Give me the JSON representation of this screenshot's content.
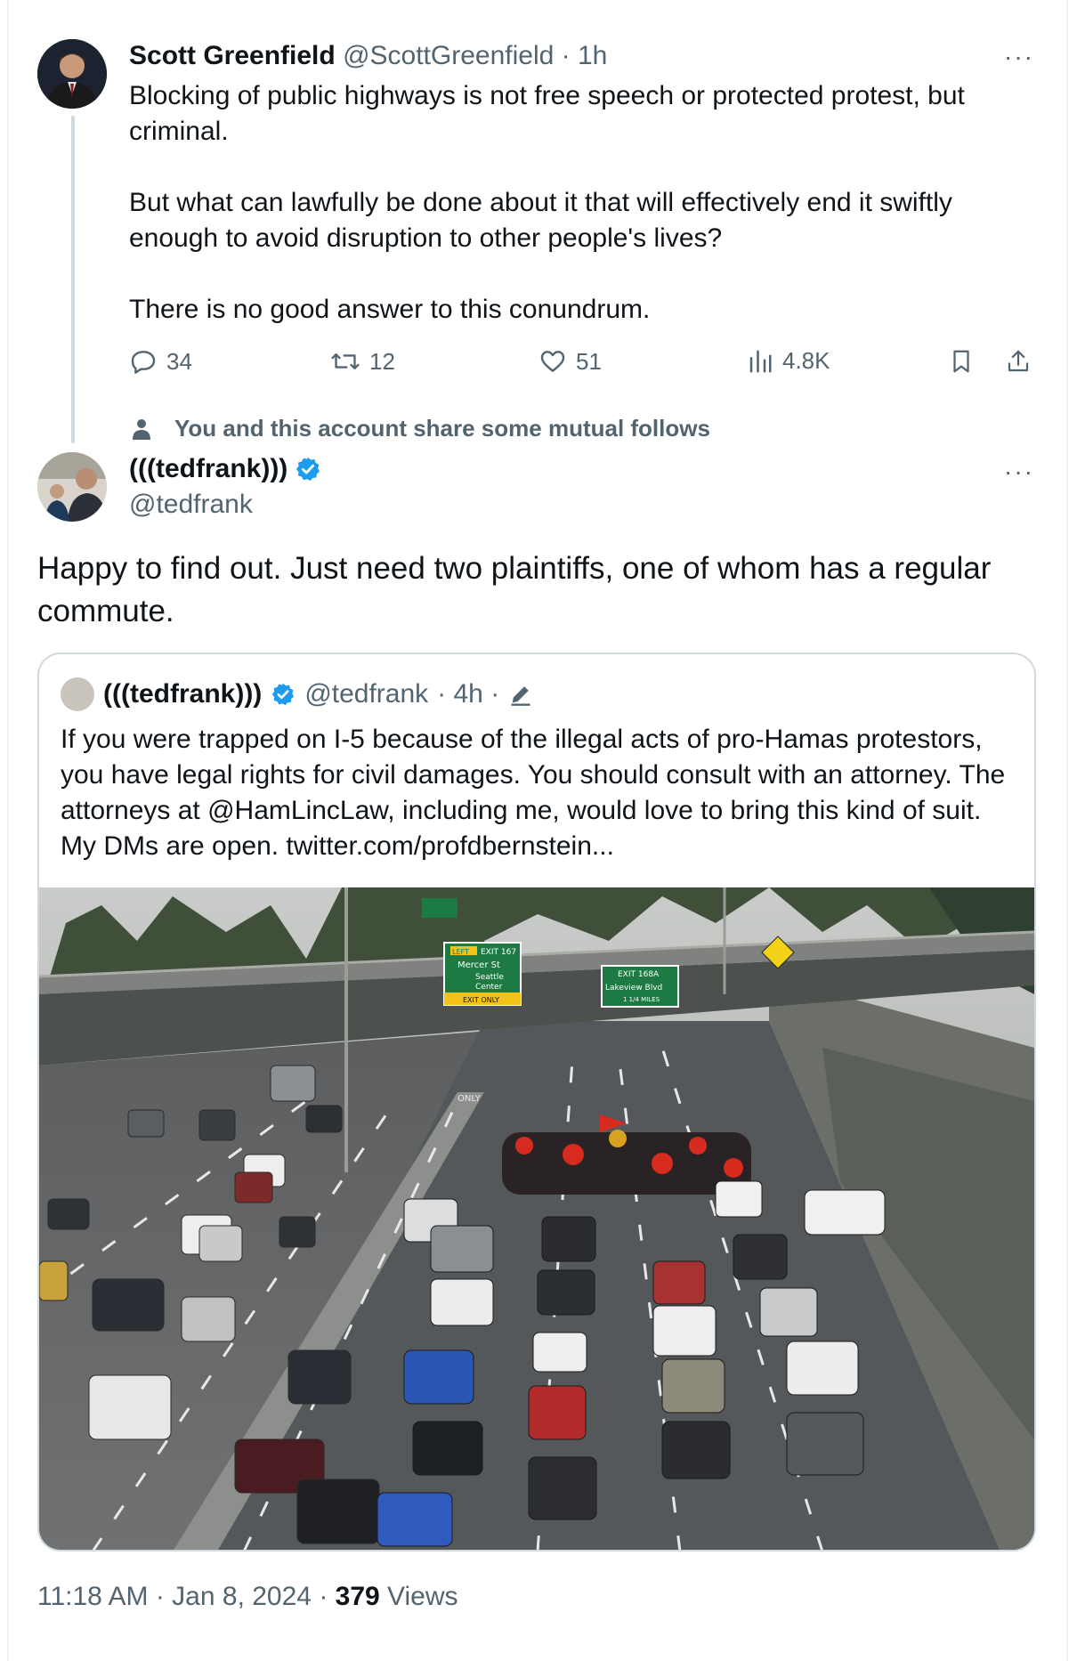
{
  "colors": {
    "text": "#0f1419",
    "muted": "#536471",
    "verified": "#1d9bf0",
    "border": "#cfd9de"
  },
  "tweet1": {
    "name": "Scott Greenfield",
    "handle": "@ScottGreenfield",
    "time": "· 1h",
    "more_icon": "more-icon",
    "lines": [
      "Blocking of public highways is not free speech or protected protest, but criminal.",
      "But what can lawfully be done about it that will effectively end it swiftly enough to avoid disruption to other people's lives?",
      "There is no good answer to this conundrum."
    ],
    "actions": {
      "replies": "34",
      "retweets": "12",
      "likes": "51",
      "views": "4.8K"
    }
  },
  "mutual_notice": "You and this account share some mutual follows",
  "tweet2": {
    "name": "(((tedfrank)))",
    "handle": "@tedfrank",
    "text": "Happy to find out. Just need two plaintiffs, one of whom has a regular commute.",
    "quote": {
      "name": "(((tedfrank)))",
      "handle": "@tedfrank",
      "time": "· 4h ·",
      "text": "If you were trapped on I-5 because of the illegal acts of pro-Hamas protestors, you have legal rights for civil damages. You should consult with an attorney. The attorneys at @HamLincLaw, including me, would love to bring this kind of suit. My DMs are open.  twitter.com/profdbernstein...",
      "photo": {
        "sign1_tag": "LEFT",
        "sign1_exit": "EXIT 167",
        "sign1_street": "Mercer St",
        "sign1_dest1": "Seattle",
        "sign1_dest2": "Center",
        "sign1_only": "EXIT ONLY",
        "sign2_exit": "EXIT 168A",
        "sign2_street": "Lakeview Blvd",
        "sign2_dist": "1 1/4 MILES",
        "road_marking": "ONLY"
      }
    },
    "timestamp": "11:18 AM · Jan 8, 2024 · ",
    "views_count": "379",
    "views_label": " Views"
  }
}
